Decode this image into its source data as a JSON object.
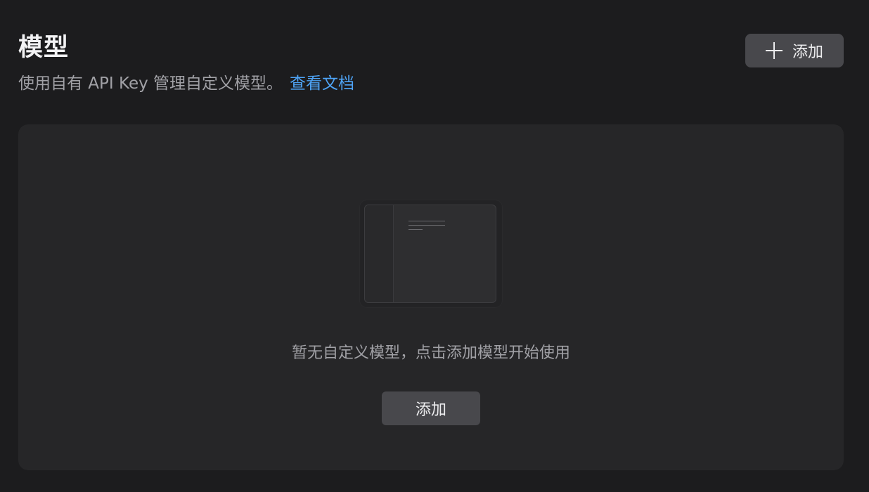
{
  "header": {
    "title": "模型",
    "subtitle": "使用自有 API Key 管理自定义模型。",
    "docs_link": "查看文档",
    "add_button_label": "添加",
    "add_icon": "plus-icon"
  },
  "empty_state": {
    "illustration": "window-illustration",
    "message": "暂无自定义模型，点击添加模型开始使用",
    "add_button_label": "添加"
  },
  "colors": {
    "background": "#1c1c1e",
    "panel": "#262628",
    "button": "#48484c",
    "link": "#4ea3f5",
    "text_primary": "#f2f2f4",
    "text_secondary": "#a1a1a6"
  }
}
